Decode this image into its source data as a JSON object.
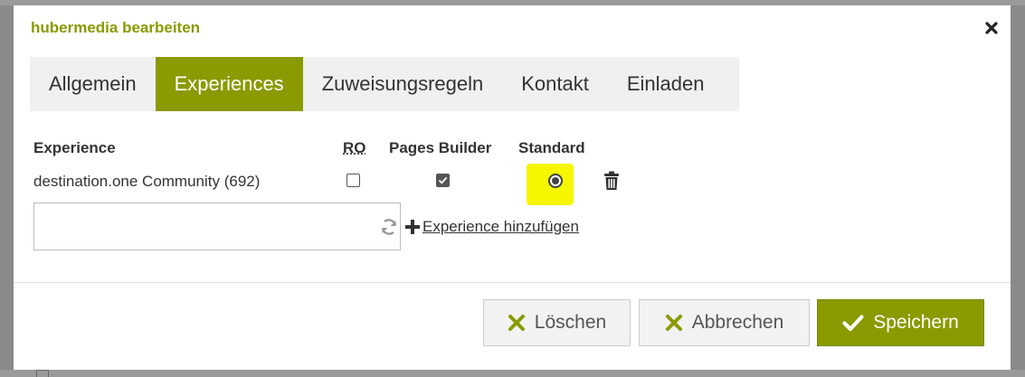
{
  "modal": {
    "title": "hubermedia bearbeiten"
  },
  "tabs": [
    {
      "label": "Allgemein",
      "active": false
    },
    {
      "label": "Experiences",
      "active": true
    },
    {
      "label": "Zuweisungsregeln",
      "active": false
    },
    {
      "label": "Kontakt",
      "active": false
    },
    {
      "label": "Einladen",
      "active": false
    }
  ],
  "table": {
    "headers": {
      "experience": "Experience",
      "ro": "RO",
      "pages_builder": "Pages Builder",
      "standard": "Standard"
    },
    "rows": [
      {
        "experience": "destination.one Community (692)",
        "ro": false,
        "pages_builder": true,
        "standard": true
      }
    ]
  },
  "add_experience": {
    "input_value": "",
    "link_label": " Experience hinzufügen"
  },
  "footer": {
    "delete_label": "Löschen",
    "cancel_label": "Abbrechen",
    "save_label": "Speichern"
  },
  "colors": {
    "accent": "#8a9a00",
    "highlight": "#f6f600"
  },
  "icons": {
    "close": "close-icon",
    "trash": "trash-icon",
    "refresh": "refresh-icon",
    "plus": "plus-icon",
    "x": "x-icon",
    "check": "check-icon"
  }
}
